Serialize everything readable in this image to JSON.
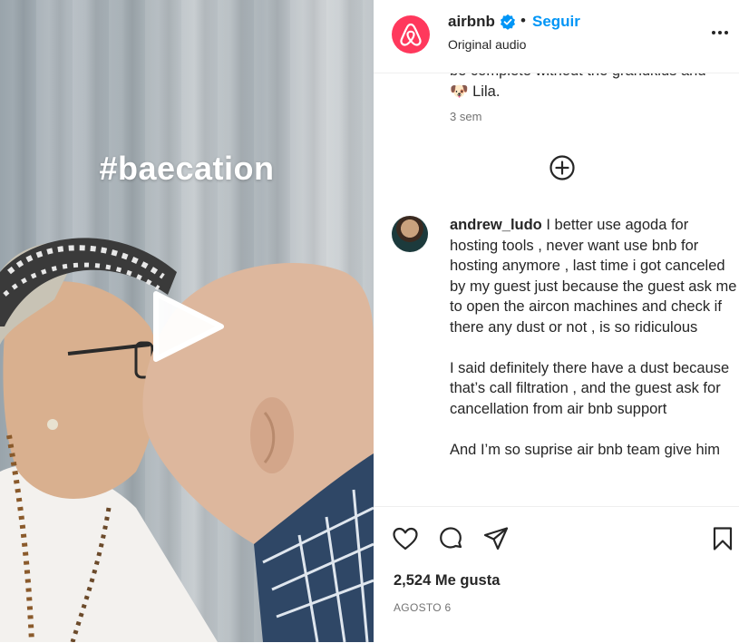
{
  "media": {
    "hashtag": "#baecation"
  },
  "header": {
    "username": "airbnb",
    "separator": "•",
    "follow_label": "Seguir",
    "audio": "Original audio",
    "brand_color": "#ff385c",
    "verified_color": "#0095f6"
  },
  "previous_comment": {
    "text": "be complete without the grandkids and 🐶 Lila.",
    "time": "3 sem"
  },
  "comment": {
    "username": "andrew_ludo",
    "text": " I better use agoda for hosting tools , never want use bnb for hosting anymore , last time i got canceled by my guest just because the guest ask me to open the aircon machines and check if there any dust or not , is so ridiculous\n\nI said definitely there have a dust because that’s call filtration , and the guest ask for cancellation from air bnb support\n\nAnd I’m so suprise air bnb team give him"
  },
  "actions": {
    "likes": "2,524 Me gusta",
    "date": "AGOSTO 6",
    "icons": [
      "heart-icon",
      "comment-icon",
      "share-icon",
      "bookmark-icon"
    ]
  }
}
